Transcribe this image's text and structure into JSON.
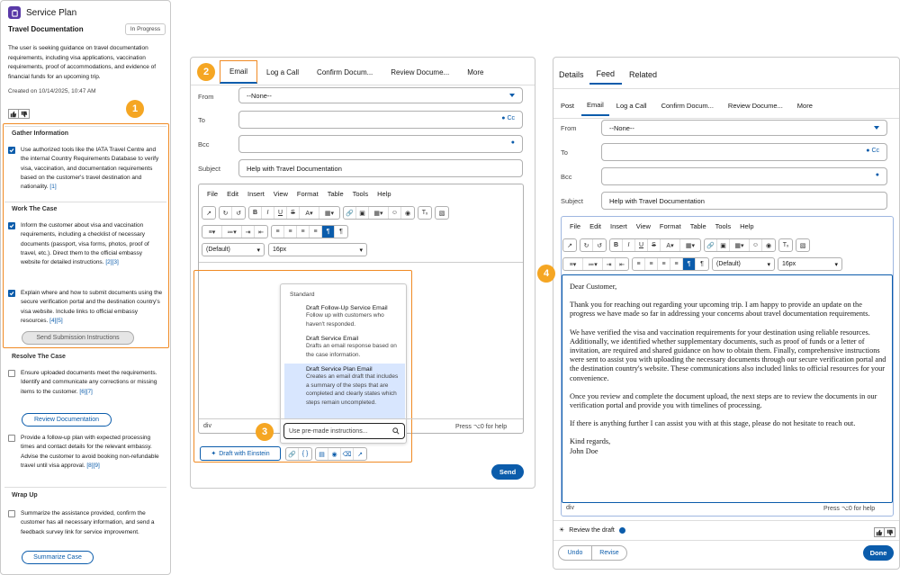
{
  "service_plan": {
    "header_title": "Service Plan",
    "plan_name": "Travel Documentation",
    "status": "In Progress",
    "summary": "The user is seeking guidance on travel documentation requirements, including visa applications, vaccination requirements, proof of accommodations, and evidence of financial funds for an upcoming trip.",
    "created": "Created on 10/14/2025, 10:47 AM",
    "sections": [
      {
        "title": "Gather Information",
        "steps": [
          {
            "text": "Use authorized tools like the IATA Travel Centre and the internal Country Requirements Database to verify visa, vaccination, and documentation requirements based on the customer's travel destination and nationality.",
            "links": "[1]",
            "checked": true
          }
        ]
      },
      {
        "title": "Work The Case",
        "steps": [
          {
            "text": "Inform the customer about visa and vaccination requirements, including a checklist of necessary documents (passport, visa forms, photos, proof of travel, etc.). Direct them to the official embassy website for detailed instructions.",
            "links": "[2][3]",
            "checked": true
          },
          {
            "text": "Explain where and how to submit documents using the secure verification portal and the destination country's visa website. Include links to official embassy resources.",
            "links": "[4][5]",
            "checked": true
          }
        ],
        "button": "Send Submission Instructions"
      },
      {
        "title": "Resolve The Case",
        "steps": [
          {
            "text": "Ensure uploaded documents meet the requirements. Identify and communicate any corrections or missing items to the customer.",
            "links": "[6][7]",
            "checked": false,
            "button": "Review Documentation"
          },
          {
            "text": "Provide a follow-up plan with expected processing times and contact details for the relevant embassy. Advise the customer to avoid booking non-refundable travel until visa approval.",
            "links": "[8][9]",
            "checked": false
          }
        ]
      },
      {
        "title": "Wrap Up",
        "steps": [
          {
            "text": "Summarize the assistance provided, confirm the customer has all necessary information, and send a feedback survey link for service improvement.",
            "links": "",
            "checked": false,
            "button": "Summarize Case"
          }
        ]
      }
    ]
  },
  "badges": {
    "one": "1",
    "two": "2",
    "three": "3",
    "four": "4"
  },
  "composer": {
    "tabs": [
      "Email",
      "Log a Call",
      "Confirm Docum...",
      "Review Docume...",
      "More"
    ],
    "from_label": "From",
    "from_value": "--None--",
    "to_label": "To",
    "cc_label": "Cc",
    "bcc_label": "Bcc",
    "subject_label": "Subject",
    "subject_value": "Help with Travel Documentation",
    "menu": [
      "File",
      "Edit",
      "Insert",
      "View",
      "Format",
      "Table",
      "Tools",
      "Help"
    ],
    "font_family": "(Default)",
    "font_size": "16px",
    "dropdown_header": "Standard",
    "dropdown_items": [
      {
        "title": "Draft Follow-Up Service Email",
        "desc": "Follow up with customers who haven't responded."
      },
      {
        "title": "Draft Service Email",
        "desc": "Drafts an email response based on the case information."
      },
      {
        "title": "Draft Service Plan Email",
        "desc": "Creates an email draft that includes a summary of the steps that are completed and clearly states which steps remain uncompleted."
      }
    ],
    "search_placeholder": "Use pre-made instructions...",
    "status_path": "div",
    "help_hint": "Press ⌥0 for help",
    "einstein_button": "Draft with Einstein",
    "send_button": "Send"
  },
  "feed": {
    "tabs": [
      "Details",
      "Feed",
      "Related"
    ],
    "sub_tabs": [
      "Post",
      "Email",
      "Log a Call",
      "Confirm Docum...",
      "Review Docume...",
      "More"
    ],
    "from_label": "From",
    "from_value": "--None--",
    "to_label": "To",
    "cc_label": "Cc",
    "bcc_label": "Bcc",
    "subject_label": "Subject",
    "subject_value": "Help with Travel Documentation",
    "menu": [
      "File",
      "Edit",
      "Insert",
      "View",
      "Format",
      "Table",
      "Tools",
      "Help"
    ],
    "font_family": "(Default)",
    "font_size": "16px",
    "letter": [
      "Dear Customer,",
      "Thank you for reaching out regarding your upcoming trip. I am happy to provide an update on the progress we have made so far in addressing your concerns about travel documentation requirements.",
      "We have verified the visa and vaccination requirements for your destination using reliable resources. Additionally, we identified whether supplementary documents, such as proof of funds or a letter of invitation, are required and shared guidance on how to obtain them. Finally, comprehensive instructions were sent to assist you with uploading the necessary documents through our secure verification portal and the destination country's website. These communications also included links to official resources for your convenience.",
      "Once you review and complete the document upload, the next steps are to review the documents in our verification portal and provide you with timelines of processing.",
      "If there is anything further I can assist you with at this stage, please do not hesitate to reach out.",
      "Kind regards,\nJohn Doe"
    ],
    "status_path": "div",
    "help_hint": "Press ⌥0 for help",
    "review_label": "Review the draft",
    "undo_button": "Undo",
    "revise_button": "Revise",
    "done_button": "Done"
  },
  "colors": {
    "brand": "#0b5cab",
    "badge": "#f5a623",
    "highlight": "#f08a24",
    "selected_item": "#d8e6fe"
  }
}
